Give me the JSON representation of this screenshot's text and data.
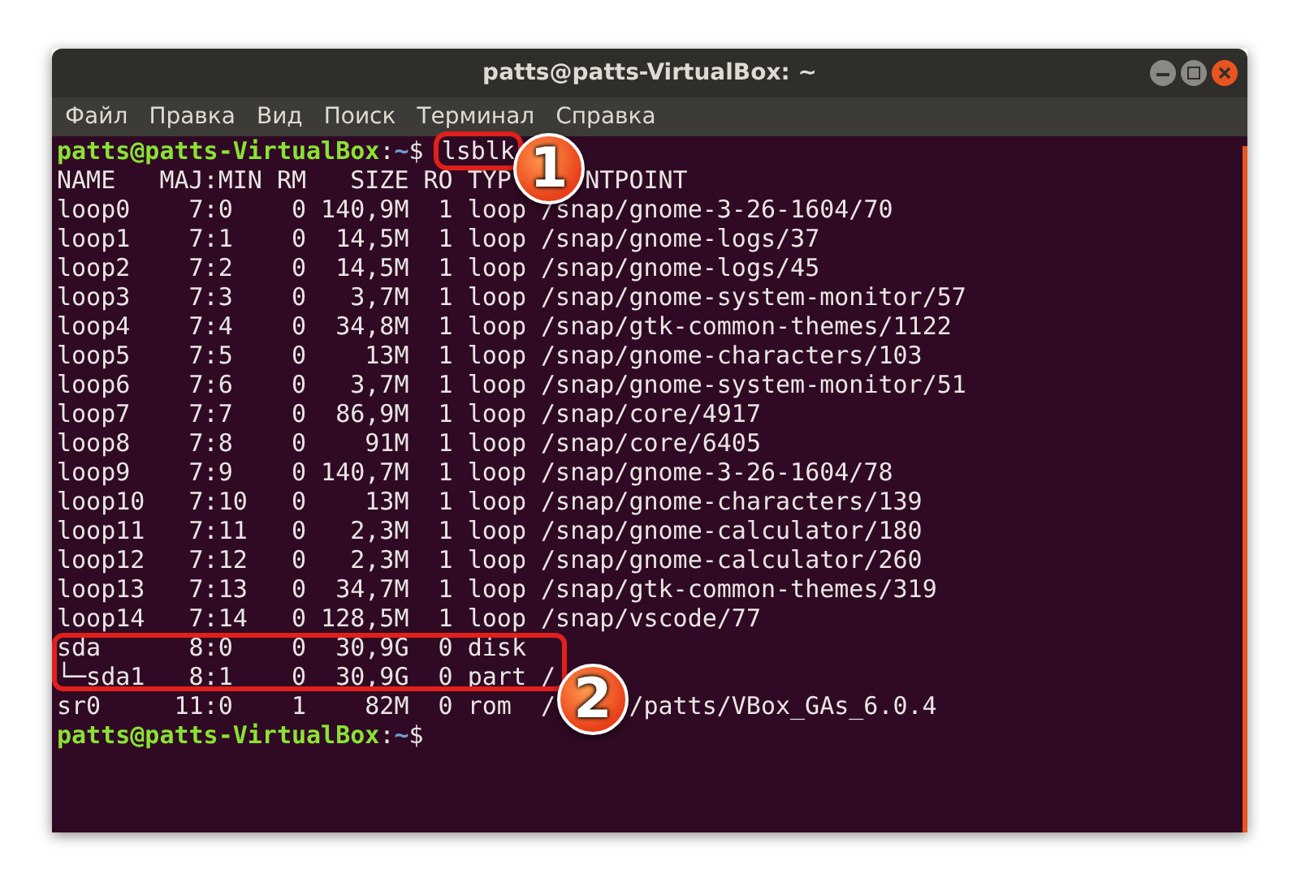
{
  "window": {
    "title": "patts@patts-VirtualBox: ~",
    "controls": [
      {
        "kind": "minimize"
      },
      {
        "kind": "maximize"
      },
      {
        "kind": "close"
      }
    ]
  },
  "menu": [
    "Файл",
    "Правка",
    "Вид",
    "Поиск",
    "Терминал",
    "Справка"
  ],
  "lines": [
    {
      "kind": "prompt",
      "user": "patts@patts-VirtualBox",
      "sep": ":",
      "path": "~",
      "sign": "$",
      "command": "lsblk",
      "highlighted": true
    },
    {
      "kind": "output",
      "parts": [
        "NAME   MAJ:MIN RM   SIZE RO TYP",
        "NTPOINT"
      ],
      "highlighted": false
    },
    {
      "kind": "output",
      "text": "loop0    7:0    0 140,9M  1 loop /snap/gnome-3-26-1604/70",
      "highlighted": false
    },
    {
      "kind": "output",
      "text": "loop1    7:1    0  14,5M  1 loop /snap/gnome-logs/37",
      "highlighted": false
    },
    {
      "kind": "output",
      "text": "loop2    7:2    0  14,5M  1 loop /snap/gnome-logs/45",
      "highlighted": false
    },
    {
      "kind": "output",
      "text": "loop3    7:3    0   3,7M  1 loop /snap/gnome-system-monitor/57",
      "highlighted": false
    },
    {
      "kind": "output",
      "text": "loop4    7:4    0  34,8M  1 loop /snap/gtk-common-themes/1122",
      "highlighted": false
    },
    {
      "kind": "output",
      "text": "loop5    7:5    0    13M  1 loop /snap/gnome-characters/103",
      "highlighted": false
    },
    {
      "kind": "output",
      "text": "loop6    7:6    0   3,7M  1 loop /snap/gnome-system-monitor/51",
      "highlighted": false
    },
    {
      "kind": "output",
      "text": "loop7    7:7    0  86,9M  1 loop /snap/core/4917",
      "highlighted": false
    },
    {
      "kind": "output",
      "text": "loop8    7:8    0    91M  1 loop /snap/core/6405",
      "highlighted": false
    },
    {
      "kind": "output",
      "text": "loop9    7:9    0 140,7M  1 loop /snap/gnome-3-26-1604/78",
      "highlighted": false
    },
    {
      "kind": "output",
      "text": "loop10   7:10   0    13M  1 loop /snap/gnome-characters/139",
      "highlighted": false
    },
    {
      "kind": "output",
      "text": "loop11   7:11   0   2,3M  1 loop /snap/gnome-calculator/180",
      "highlighted": false
    },
    {
      "kind": "output",
      "text": "loop12   7:12   0   2,3M  1 loop /snap/gnome-calculator/260",
      "highlighted": false
    },
    {
      "kind": "output",
      "text": "loop13   7:13   0  34,7M  1 loop /snap/gtk-common-themes/319",
      "highlighted": false
    },
    {
      "kind": "output",
      "text": "loop14   7:14   0 128,5M  1 loop /snap/vscode/77",
      "highlighted": false
    },
    {
      "kind": "output",
      "text": "sda      8:0    0  30,9G  0 disk",
      "highlighted": true
    },
    {
      "kind": "output",
      "text": "└─sda1   8:1    0  30,9G  0 part /",
      "highlighted": true
    },
    {
      "kind": "output",
      "parts": [
        "sr0     11:0    1    82M  0 rom  /",
        "/patts/VBox_GAs_6.0.4"
      ],
      "highlighted": false
    },
    {
      "kind": "prompt",
      "user": "patts@patts-VirtualBox",
      "sep": ":",
      "path": "~",
      "sign": "$"
    }
  ],
  "callouts": [
    "1",
    "2"
  ]
}
